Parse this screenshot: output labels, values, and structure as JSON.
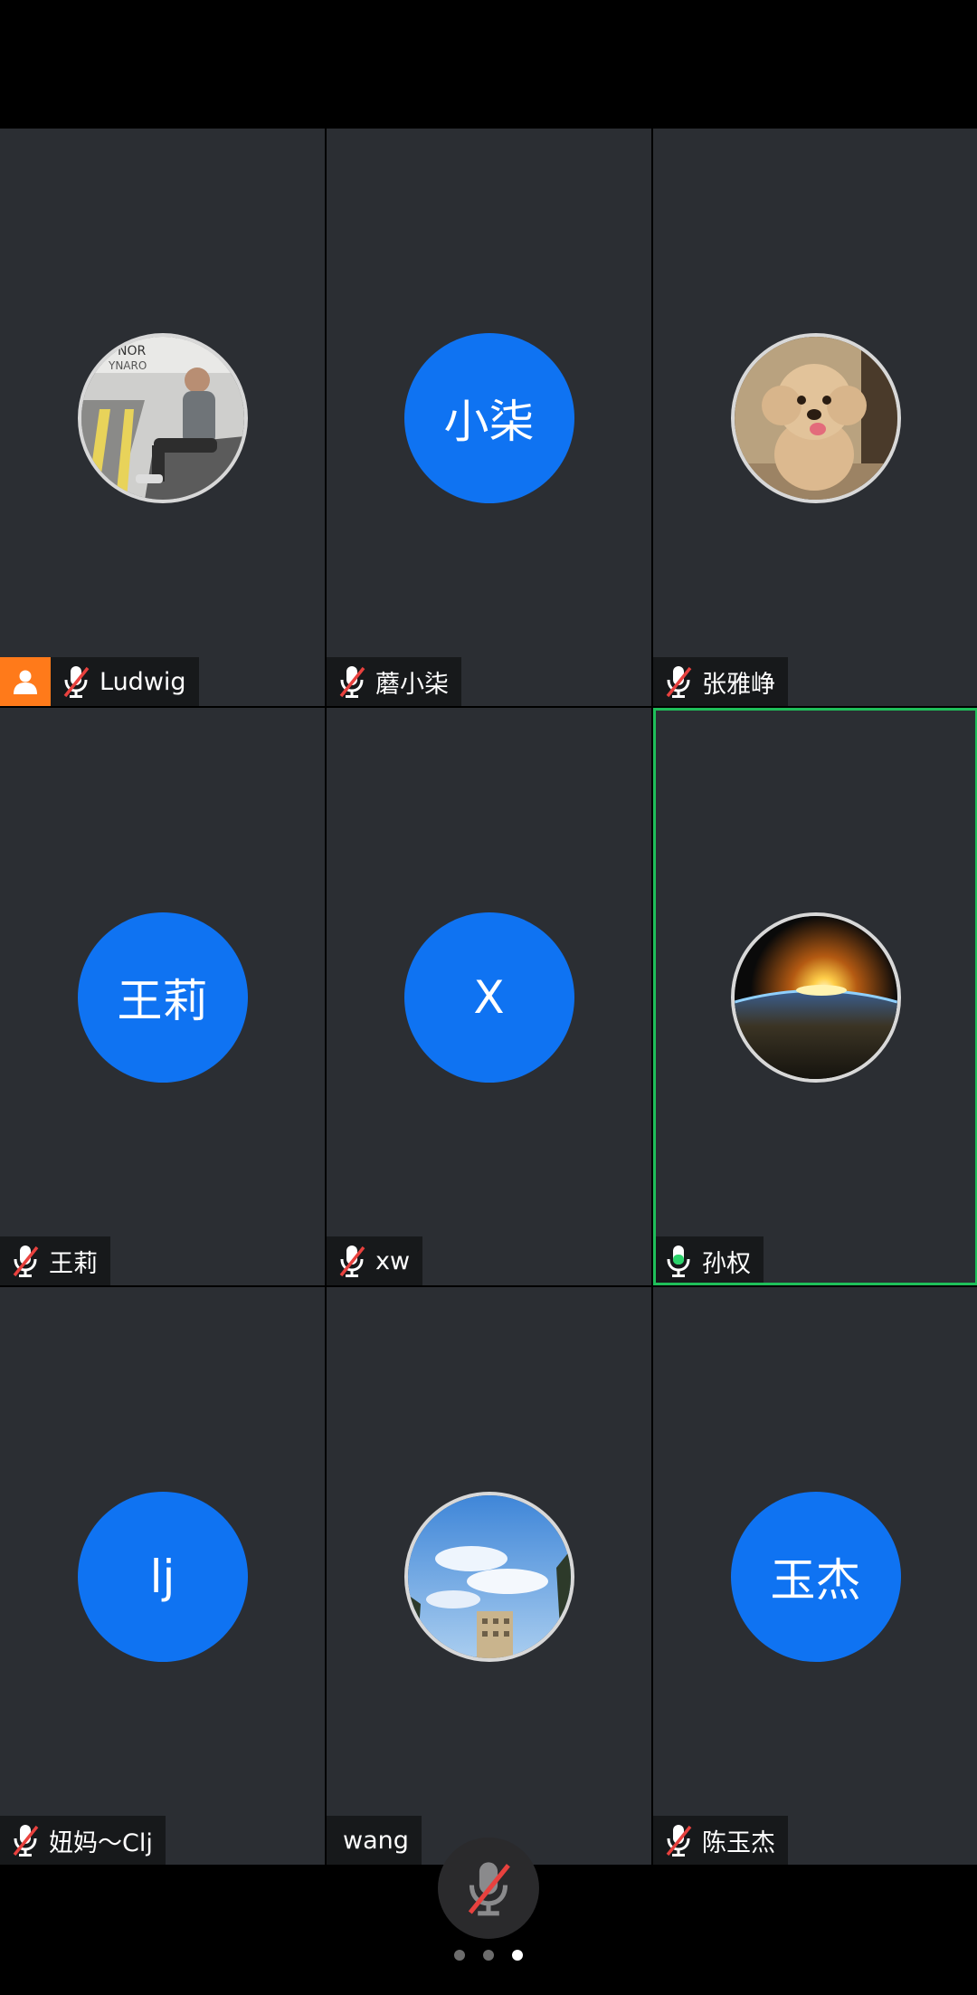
{
  "participants": [
    {
      "name": "Ludwig",
      "avatar": "photo",
      "avatar_icon": "man-sitting-photo",
      "mic": "muted",
      "host": true,
      "speaking": false
    },
    {
      "name": "蘑小柒",
      "avatar": "initials",
      "initials": "小柒",
      "mic": "muted",
      "host": false,
      "speaking": false
    },
    {
      "name": "张雅峥",
      "avatar": "photo",
      "avatar_icon": "poodle-dog-photo",
      "mic": "muted",
      "host": false,
      "speaking": false
    },
    {
      "name": "王莉",
      "avatar": "initials",
      "initials": "王莉",
      "mic": "muted",
      "host": false,
      "speaking": false
    },
    {
      "name": "xw",
      "avatar": "initials",
      "initials": "X",
      "mic": "muted",
      "host": false,
      "speaking": false
    },
    {
      "name": "孙权",
      "avatar": "photo",
      "avatar_icon": "earth-sunrise-photo",
      "mic": "active",
      "host": false,
      "speaking": true
    },
    {
      "name": "妞妈～Clj",
      "avatar": "initials",
      "initials": "lj",
      "mic": "muted",
      "host": false,
      "speaking": false
    },
    {
      "name": "wang",
      "avatar": "photo",
      "avatar_icon": "sky-building-photo",
      "mic": "none",
      "host": false,
      "speaking": false
    },
    {
      "name": "陈玉杰",
      "avatar": "initials",
      "initials": "玉杰",
      "mic": "muted",
      "host": false,
      "speaking": false
    }
  ],
  "controls": {
    "mic_button_icon": "mic-muted-icon",
    "page_indicator": {
      "total": 3,
      "current": 3
    }
  },
  "colors": {
    "tile_bg": "#2b2e33",
    "initials_avatar": "#0f73f2",
    "host_badge": "#ff7a1a",
    "speaking_border": "#1fbf5a",
    "muted_slash": "#e8413e",
    "active_mic": "#2bd46b"
  }
}
